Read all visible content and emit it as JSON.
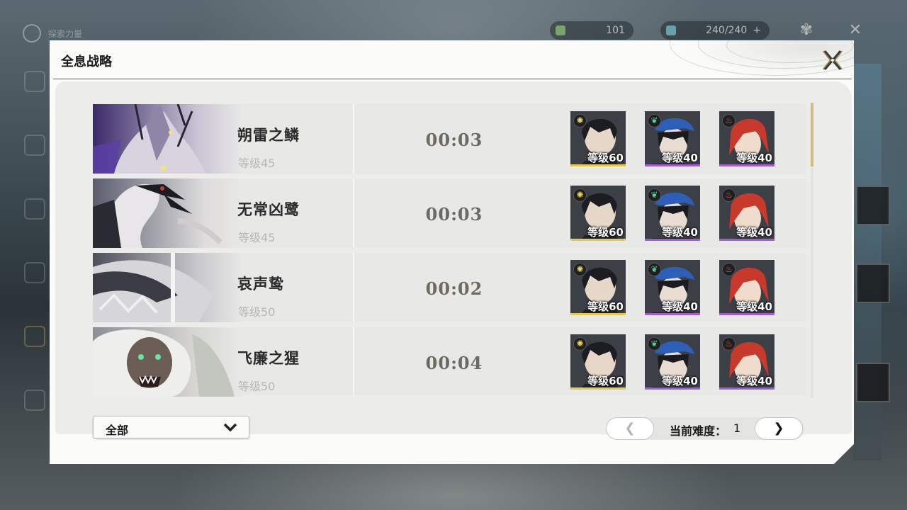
{
  "background": {
    "hud_left_label": "探索力量",
    "stamina_value": "101",
    "currency_value": "240/240",
    "currency_plus": "+"
  },
  "panel": {
    "title": "全息战略",
    "close_icon": "close-x-icon"
  },
  "rows": [
    {
      "name": "朔雷之鳞",
      "level": "等级45",
      "time": "00:03",
      "portrait": "thunder-scale-boss",
      "team": [
        {
          "level": "等级60",
          "element": "spectro",
          "rarity_color": "#e6c84a"
        },
        {
          "level": "等级40",
          "element": "aero",
          "rarity_color": "#a35ad6"
        },
        {
          "level": "等级40",
          "element": "fusion",
          "rarity_color": "#a35ad6"
        }
      ]
    },
    {
      "name": "无常凶鹭",
      "level": "等级45",
      "time": "00:03",
      "portrait": "heron-boss",
      "team": [
        {
          "level": "等级60",
          "element": "spectro",
          "rarity_color": "#e6c84a"
        },
        {
          "level": "等级40",
          "element": "aero",
          "rarity_color": "#a35ad6"
        },
        {
          "level": "等级40",
          "element": "fusion",
          "rarity_color": "#a35ad6"
        }
      ]
    },
    {
      "name": "哀声鸷",
      "level": "等级50",
      "time": "00:02",
      "portrait": "mourning-aix-boss",
      "team": [
        {
          "level": "等级60",
          "element": "spectro",
          "rarity_color": "#e6c84a"
        },
        {
          "level": "等级40",
          "element": "aero",
          "rarity_color": "#a35ad6"
        },
        {
          "level": "等级40",
          "element": "fusion",
          "rarity_color": "#a35ad6"
        }
      ]
    },
    {
      "name": "飞廉之猩",
      "level": "等级50",
      "time": "00:04",
      "portrait": "ape-boss",
      "team": [
        {
          "level": "等级60",
          "element": "spectro",
          "rarity_color": "#e6c84a"
        },
        {
          "level": "等级40",
          "element": "aero",
          "rarity_color": "#a35ad6"
        },
        {
          "level": "等级40",
          "element": "fusion",
          "rarity_color": "#a35ad6"
        }
      ]
    }
  ],
  "filter": {
    "selected": "全部",
    "icon": "chevron-down-icon"
  },
  "pager": {
    "prev_label": "❮",
    "next_label": "❯",
    "difficulty_label": "当前难度：",
    "difficulty_value": "1"
  },
  "colors": {
    "accent_gold": "#d2bc82",
    "rarity_5star": "#e6c84a",
    "rarity_4star": "#a35ad6"
  }
}
